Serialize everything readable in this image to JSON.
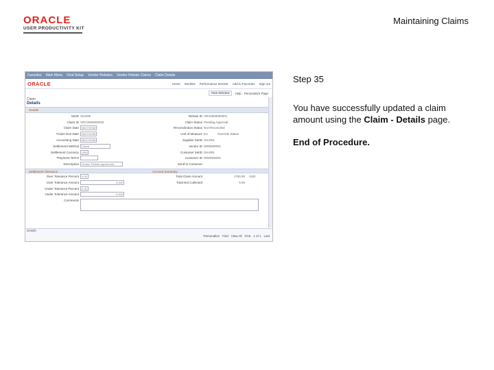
{
  "header": {
    "logo_brand": "ORACLE",
    "logo_sub": "USER PRODUCTIVITY KIT",
    "title": "Maintaining Claims"
  },
  "step": {
    "label": "Step 35",
    "desc_pre": "You have successfully updated a claim amount using the ",
    "desc_bold": "Claim - Details",
    "desc_post": " page.",
    "end": "End of Procedure."
  },
  "screenshot": {
    "nav": [
      "Favorites",
      "Main Menu",
      "Deal Setup",
      "Vendor Rebates",
      "Vendor Rebate Claims",
      "Claim Details"
    ],
    "brand": "ORACLE",
    "top_links": [
      "Home",
      "Worklist",
      "Performance Monitor",
      "Add to Favorites",
      "Sign out"
    ],
    "sub_links": [
      "New Window",
      "Help",
      "Personalize Page"
    ],
    "page_title_small": "Claim",
    "page_title": "Details",
    "section_header": "Header",
    "left_fields": [
      {
        "label": "SetID",
        "value": "SHARE"
      },
      {
        "label": "Claim ID",
        "value": "VRC0000000030"
      },
      {
        "label": "Claim Date",
        "value": "08/27/2008"
      },
      {
        "label": "*Claim Due Date",
        "value": "08/27/2008"
      },
      {
        "label": "Accounting Date",
        "value": "08/27/2008"
      },
      {
        "label": "Settlement Method",
        "value": "Check"
      },
      {
        "label": "Settlement Currency",
        "value": "USD"
      },
      {
        "label": "*Payment Terms",
        "value": ""
      },
      {
        "label": "Description",
        "value": "Vendor Rebate Agreement"
      }
    ],
    "right_fields": [
      {
        "label": "Rebate ID",
        "value": "VRA0000000001"
      },
      {
        "label": "Claim Status",
        "value": "Pending Approval"
      },
      {
        "label": "Reconciliation Status",
        "value": "Not Reconciled"
      },
      {
        "label": "Unit of Measure",
        "value": "EA"
      },
      {
        "label": "Supplier SetID",
        "value": "SHARE"
      },
      {
        "label": "Vendor ID",
        "value": "0000000001"
      },
      {
        "label": "Customer SetID",
        "value": "SHARE"
      },
      {
        "label": "Customer ID",
        "value": "0000000001"
      },
      {
        "label": "Send to Customer",
        "value": ""
      }
    ],
    "override_label": "Override Status",
    "settlement_section": "Settlement Tolerance",
    "summary_section": "Account Summary",
    "settlement_fields": [
      {
        "label": "Over Tolerance Percent",
        "value": "0.00"
      },
      {
        "label": "Over Tolerance Amount",
        "value": "0.000"
      },
      {
        "label": "Under Tolerance Percent",
        "value": "0.00"
      },
      {
        "label": "Under Tolerance Amount",
        "value": "0.000"
      }
    ],
    "summary_fields": [
      {
        "label": "Total Claim Amount",
        "value": "1750.00",
        "cur": "USD"
      },
      {
        "label": "Total Not Collected",
        "value": "0.00",
        "cur": ""
      }
    ],
    "comments_label": "Comments",
    "footer_label": "Details",
    "pager": [
      "Personalize",
      "Find",
      "View All",
      "First",
      "1 of 1",
      "Last"
    ]
  }
}
